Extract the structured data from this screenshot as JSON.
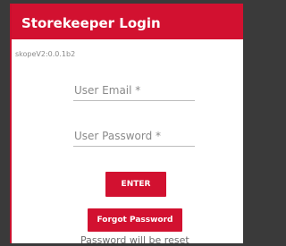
{
  "header": {
    "title": "Storekeeper Login"
  },
  "version": "skopeV2:0.0.1b2",
  "form": {
    "email_placeholder": "User Email *",
    "email_value": "",
    "password_placeholder": "User Password *",
    "password_value": ""
  },
  "buttons": {
    "enter_label": "ENTER",
    "forgot_label": "Forgot Password"
  },
  "reset_note": "Password will be reset",
  "colors": {
    "brand": "#d21130",
    "backdrop": "#3a3a3a"
  }
}
